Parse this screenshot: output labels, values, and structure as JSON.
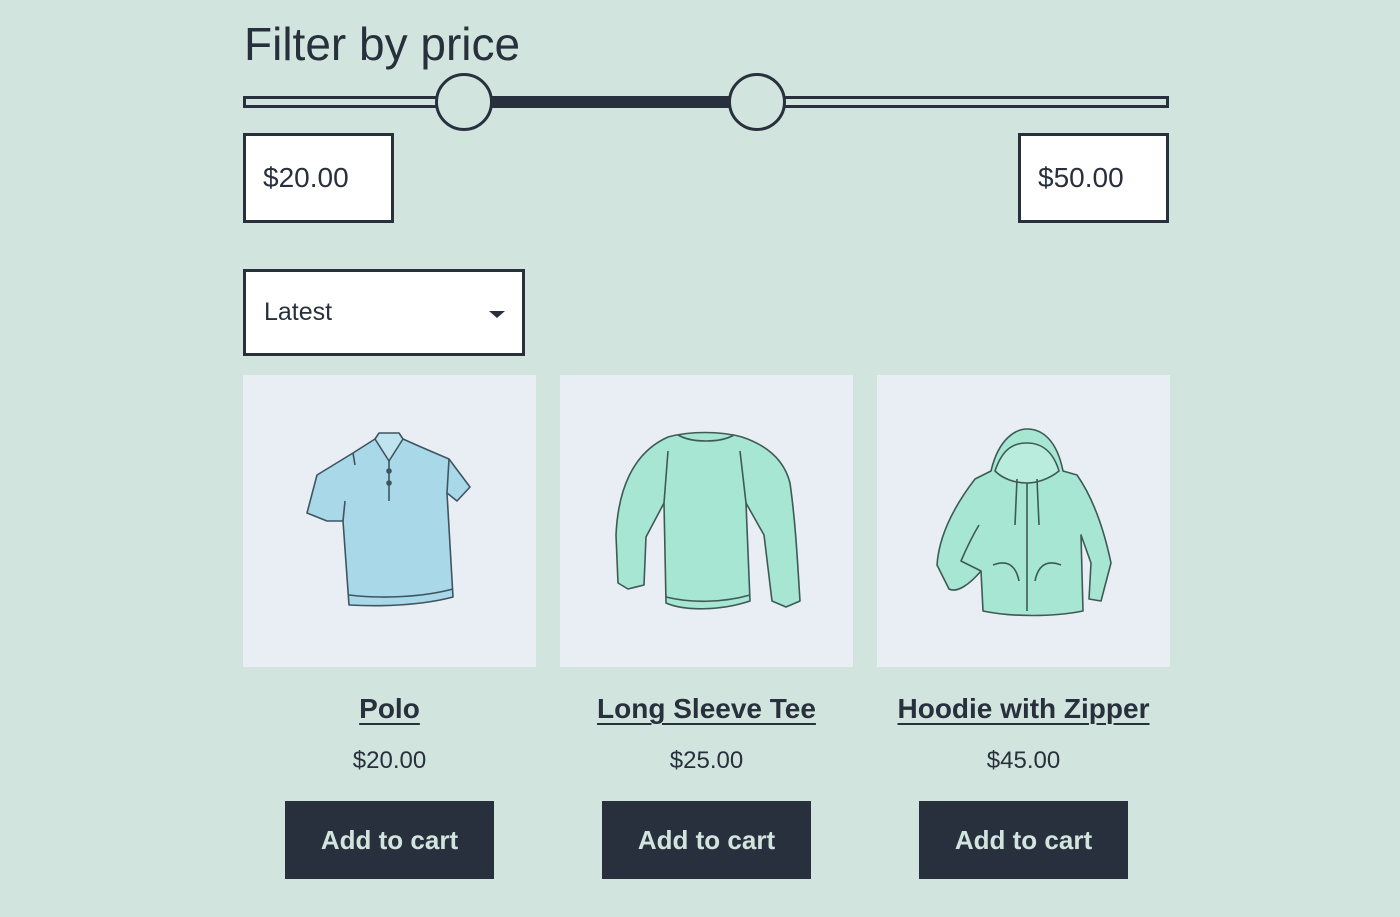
{
  "filter": {
    "title": "Filter by price",
    "min_value": "$20.00",
    "max_value": "$50.00",
    "slider_min_fraction": 0.239,
    "slider_max_fraction": 0.555
  },
  "sort": {
    "selected": "Latest"
  },
  "products": [
    {
      "name": "Polo",
      "price": "$20.00",
      "button_label": "Add to cart",
      "icon": "polo-shirt-icon",
      "color": "#8ecfdf"
    },
    {
      "name": "Long Sleeve Tee",
      "price": "$25.00",
      "button_label": "Add to cart",
      "icon": "long-sleeve-tee-icon",
      "color": "#8fe0c9"
    },
    {
      "name": "Hoodie with Zipper",
      "price": "$45.00",
      "button_label": "Add to cart",
      "icon": "hoodie-icon",
      "color": "#8fe0c9"
    }
  ],
  "colors": {
    "background": "#d1e4dd",
    "foreground": "#28303d",
    "thumb_background": "#e9eef4"
  }
}
